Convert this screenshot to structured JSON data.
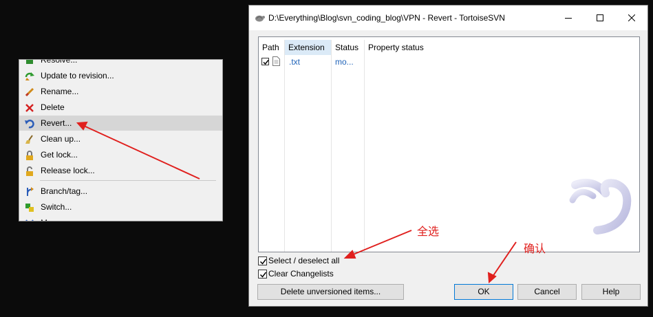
{
  "context_menu": {
    "items": [
      {
        "label": "Resolve...",
        "icon": "resolve-icon"
      },
      {
        "label": "Update to revision...",
        "icon": "update-icon"
      },
      {
        "label": "Rename...",
        "icon": "rename-icon"
      },
      {
        "label": "Delete",
        "icon": "delete-icon"
      },
      {
        "label": "Revert...",
        "icon": "revert-icon",
        "highlighted": true
      },
      {
        "label": "Clean up...",
        "icon": "cleanup-icon"
      },
      {
        "label": "Get lock...",
        "icon": "lock-icon"
      },
      {
        "label": "Release lock...",
        "icon": "unlock-icon"
      },
      {
        "label": "Branch/tag...",
        "icon": "branch-icon"
      },
      {
        "label": "Switch...",
        "icon": "switch-icon"
      },
      {
        "label": "M",
        "icon": "merge-icon"
      }
    ]
  },
  "dialog": {
    "title": "D:\\Everything\\Blog\\svn_coding_blog\\VPN - Revert - TortoiseSVN",
    "columns": [
      "Path",
      "Extension",
      "Status",
      "Property status"
    ],
    "rows": [
      {
        "checked": true,
        "path": "",
        "extension": ".txt",
        "status": "mo...",
        "property_status": ""
      }
    ],
    "select_all_label": "Select / deselect all",
    "select_all_checked": true,
    "clear_changelists_label": "Clear Changelists",
    "clear_changelists_checked": true,
    "delete_unversioned_label": "Delete unversioned items...",
    "ok_label": "OK",
    "cancel_label": "Cancel",
    "help_label": "Help"
  },
  "annotations": {
    "select_all_note": "全选",
    "confirm_note": "确认"
  },
  "colors": {
    "annotation": "#e0201e",
    "menu_highlight": "#d6d6d6",
    "header_selected": "#dbeaf7",
    "link_blue": "#1e62b8"
  }
}
